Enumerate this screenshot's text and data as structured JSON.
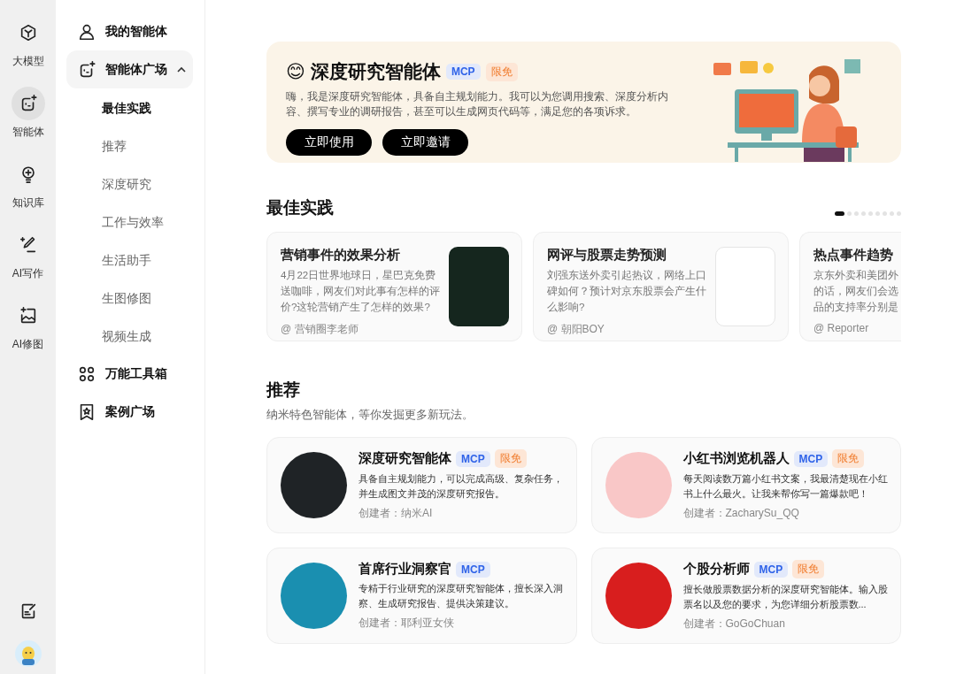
{
  "rail": {
    "items": [
      {
        "label": "大模型",
        "selected": false
      },
      {
        "label": "智能体",
        "selected": true
      },
      {
        "label": "知识库",
        "selected": false
      },
      {
        "label": "AI写作",
        "selected": false
      },
      {
        "label": "AI修图",
        "selected": false
      }
    ]
  },
  "nav": {
    "items": [
      {
        "label": "我的智能体"
      },
      {
        "label": "智能体广场",
        "expanded": true,
        "children": [
          {
            "label": "最佳实践",
            "selected": true
          },
          {
            "label": "推荐",
            "selected": false
          },
          {
            "label": "深度研究",
            "selected": false
          },
          {
            "label": "工作与效率",
            "selected": false
          },
          {
            "label": "生活助手",
            "selected": false
          },
          {
            "label": "生图修图",
            "selected": false
          },
          {
            "label": "视频生成",
            "selected": false
          }
        ]
      },
      {
        "label": "万能工具箱"
      },
      {
        "label": "案例广场"
      }
    ]
  },
  "banner": {
    "emoji": "😊",
    "title": "深度研究智能体",
    "tags": [
      {
        "kind": "mcp",
        "text": "MCP"
      },
      {
        "kind": "free",
        "text": "限免"
      }
    ],
    "description": "嗨，我是深度研究智能体，具备自主规划能力。我可以为您调用搜索、深度分析内容、撰写专业的调研报告，甚至可以生成网页代码等，满足您的各项诉求。",
    "buttons": [
      "立即使用",
      "立即邀请"
    ]
  },
  "best_practice": {
    "title": "最佳实践",
    "pager": [
      {
        "selected": true
      },
      {
        "selected": false
      },
      {
        "selected": false
      },
      {
        "selected": false
      },
      {
        "selected": false
      },
      {
        "selected": false
      },
      {
        "selected": false
      },
      {
        "selected": false
      },
      {
        "selected": false
      }
    ],
    "cards": [
      {
        "kind": "full",
        "title": "营销事件的效果分析",
        "description": "4月22日世界地球日，星巴克免费送咖啡，网友们对此事有怎样的评价?这轮营销产生了怎样的效果?",
        "author": "@ 营销圈李老师"
      },
      {
        "kind": "full",
        "title": "网评与股票走势预测",
        "description": "刘强东送外卖引起热议，网络上口碑如何？预计对京东股票会产生什么影响?",
        "author": "@ 朝阳BOY"
      },
      {
        "kind": "cut",
        "title": "热点事件趋势",
        "lines": [
          "京东外卖和美团外",
          "的话，网友们会选",
          "品的支持率分别是"
        ],
        "author": "@ Reporter"
      }
    ]
  },
  "recommend": {
    "title": "推荐",
    "subtitle": "纳米特色智能体，等你发掘更多新玩法。",
    "cards": [
      {
        "name": "深度研究智能体",
        "tags": [
          {
            "kind": "mcp",
            "text": "MCP"
          },
          {
            "kind": "free",
            "text": "限免"
          }
        ],
        "description": "具备自主规划能力，可以完成高级、复杂任务，并生成图文并茂的深度研究报告。",
        "creator": "创建者：纳米AI"
      },
      {
        "name": "小红书浏览机器人",
        "tags": [
          {
            "kind": "mcp",
            "text": "MCP"
          },
          {
            "kind": "free",
            "text": "限免"
          }
        ],
        "description": "每天阅读数万篇小红书文案，我最清楚现在小红书上什么最火。让我来帮你写一篇爆款吧！",
        "creator": "创建者：ZacharySu_QQ"
      },
      {
        "name": "首席行业洞察官",
        "tags": [
          {
            "kind": "mcp",
            "text": "MCP"
          }
        ],
        "description": "专精于行业研究的深度研究智能体，擅长深入洞察、生成研究报告、提供决策建议。",
        "creator": "创建者：耶利亚女侠"
      },
      {
        "name": "个股分析师",
        "tags": [
          {
            "kind": "mcp",
            "text": "MCP"
          },
          {
            "kind": "free",
            "text": "限免"
          }
        ],
        "description": "擅长做股票数据分析的深度研究智能体。输入股票名以及您的要求，为您详细分析股票数...",
        "creator": "创建者：GoGoChuan"
      }
    ]
  }
}
